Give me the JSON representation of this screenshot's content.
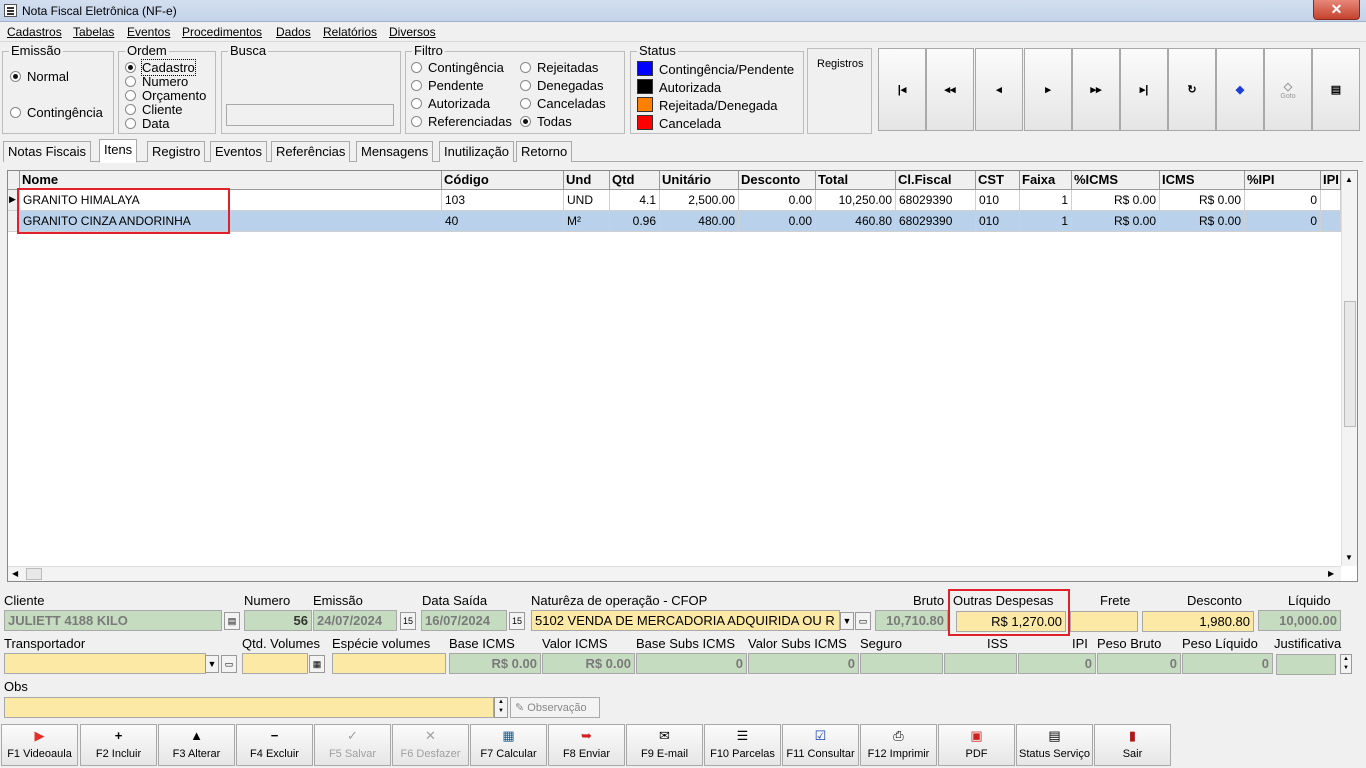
{
  "window": {
    "title": "Nota Fiscal Eletrônica (NF-e)"
  },
  "menu": [
    "Cadastros",
    "Tabelas",
    "Eventos",
    "Procedimentos",
    "Dados",
    "Relatórios",
    "Diversos"
  ],
  "emissao": {
    "legend": "Emissão",
    "options": [
      "Normal",
      "Contingência"
    ],
    "selected": "Normal"
  },
  "ordem": {
    "legend": "Ordem",
    "options": [
      "Cadastro",
      "Numero",
      "Orçamento",
      "Cliente",
      "Data"
    ],
    "selected": "Cadastro"
  },
  "busca": {
    "legend": "Busca",
    "value": ""
  },
  "filtro": {
    "legend": "Filtro",
    "col1": [
      "Contingência",
      "Pendente",
      "Autorizada",
      "Referenciadas"
    ],
    "col2": [
      "Rejeitadas",
      "Denegadas",
      "Canceladas",
      "Todas"
    ],
    "selected": "Todas"
  },
  "status": {
    "legend": "Status",
    "items": [
      {
        "label": "Contingência/Pendente",
        "color": "#0000ff"
      },
      {
        "label": "Autorizada",
        "color": "#000000"
      },
      {
        "label": "Rejeitada/Denegada",
        "color": "#ff8000"
      },
      {
        "label": "Cancelada",
        "color": "#ff0000"
      }
    ]
  },
  "registros": {
    "label": "Registros"
  },
  "nav_buttons": [
    "first-icon",
    "rewind-icon",
    "prev-icon",
    "next-icon",
    "fast-forward-icon",
    "last-icon",
    "refresh-icon",
    "tag-icon",
    "goto-icon",
    "form-icon"
  ],
  "goto_label": "Goto",
  "tabs": [
    "Notas Fiscais",
    "Itens",
    "Registro",
    "Eventos",
    "Referências",
    "Mensagens",
    "Inutilização",
    "Retorno"
  ],
  "active_tab": "Itens",
  "grid": {
    "columns": [
      "Nome",
      "Código",
      "Und",
      "Qtd",
      "Unitário",
      "Desconto",
      "Total",
      "Cl.Fiscal",
      "CST",
      "Faixa",
      "%ICMS",
      "ICMS",
      "%IPI",
      "IPI"
    ],
    "rows": [
      [
        "GRANITO HIMALAYA",
        "103",
        "UND",
        "4.1",
        "2,500.00",
        "0.00",
        "10,250.00",
        "68029390",
        "010",
        "1",
        "R$ 0.00",
        "R$ 0.00",
        "0",
        ""
      ],
      [
        "GRANITO CINZA ANDORINHA",
        "40",
        "M²",
        "0.96",
        "480.00",
        "0.00",
        "460.80",
        "68029390",
        "010",
        "1",
        "R$ 0.00",
        "R$ 0.00",
        "0",
        ""
      ]
    ]
  },
  "form": {
    "cliente_label": "Cliente",
    "cliente": "JULIETT 4188 KILO",
    "numero_label": "Numero",
    "numero": "56",
    "emissao_label": "Emissão",
    "emissao": "24/07/2024",
    "data_saida_label": "Data Saída",
    "data_saida": "16/07/2024",
    "natureza_label": "Naturêza de operação - CFOP",
    "natureza": "5102 VENDA DE MERCADORIA ADQUIRIDA OU R",
    "bruto_label": "Bruto",
    "bruto": "10,710.80",
    "outras_label": "Outras Despesas",
    "outras": "R$ 1,270.00",
    "frete_label": "Frete",
    "frete": "",
    "desconto_label": "Desconto",
    "desconto": "1,980.80",
    "liquido_label": "Líquido",
    "liquido": "10,000.00",
    "transportador_label": "Transportador",
    "transportador": "",
    "qtd_volumes_label": "Qtd. Volumes",
    "qtd_volumes": "",
    "especie_label": "Espécie volumes",
    "especie": "",
    "base_icms_label": "Base ICMS",
    "base_icms": "R$ 0.00",
    "valor_icms_label": "Valor ICMS",
    "valor_icms": "R$ 0.00",
    "base_subs_label": "Base Subs ICMS",
    "base_subs": "0",
    "valor_subs_label": "Valor Subs ICMS",
    "valor_subs": "0",
    "seguro_label": "Seguro",
    "seguro": "",
    "iss_label": "ISS",
    "iss": "",
    "ipi_label": "IPI",
    "ipi": "0",
    "peso_bruto_label": "Peso Bruto",
    "peso_bruto": "0",
    "peso_liquido_label": "Peso Líquido",
    "peso_liquido": "0",
    "justificativa_label": "Justificativa",
    "justificativa": "",
    "obs_label": "Obs",
    "obs": "",
    "observacao_btn": "Observação"
  },
  "footer_buttons": [
    {
      "label": "F1 Videoaula",
      "icon": "youtube-icon",
      "enabled": true
    },
    {
      "label": "F2 Incluir",
      "icon": "plus-icon",
      "enabled": true
    },
    {
      "label": "F3 Alterar",
      "icon": "up-arrow-icon",
      "enabled": true
    },
    {
      "label": "F4 Excluir",
      "icon": "minus-icon",
      "enabled": true
    },
    {
      "label": "F5 Salvar",
      "icon": "check-icon",
      "enabled": false
    },
    {
      "label": "F6 Desfazer",
      "icon": "x-icon",
      "enabled": false
    },
    {
      "label": "F7 Calcular",
      "icon": "calculator-icon",
      "enabled": true
    },
    {
      "label": "F8 Enviar",
      "icon": "send-icon",
      "enabled": true
    },
    {
      "label": "F9 E-mail",
      "icon": "mail-icon",
      "enabled": true
    },
    {
      "label": "F10 Parcelas",
      "icon": "list-icon",
      "enabled": true
    },
    {
      "label": "F11 Consultar",
      "icon": "consult-icon",
      "enabled": true
    },
    {
      "label": "F12 Imprimir",
      "icon": "printer-icon",
      "enabled": true
    },
    {
      "label": "PDF",
      "icon": "pdf-icon",
      "enabled": true
    },
    {
      "label": "Status Serviço",
      "icon": "server-icon",
      "enabled": true
    },
    {
      "label": "Sair",
      "icon": "exit-icon",
      "enabled": true
    }
  ]
}
